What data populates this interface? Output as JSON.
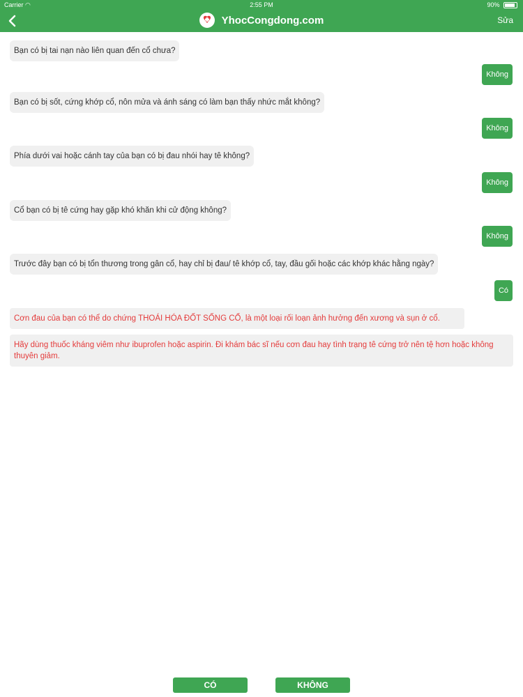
{
  "status": {
    "carrier": "Carrier",
    "time": "2:55 PM",
    "battery": "90%"
  },
  "nav": {
    "brand": "YhocCongdong.com",
    "edit": "Sửa"
  },
  "conversation": [
    {
      "question": "Bạn có bị tai nạn nào liên quan đến cổ chưa?",
      "answer": "Không"
    },
    {
      "question": "Bạn có bị sốt, cứng khớp cổ, nôn mửa và ánh sáng có làm bạn thấy nhức mắt không?",
      "answer": "Không"
    },
    {
      "question": "Phía dưới vai hoặc cánh tay của bạn có bị đau nhói hay tê không?",
      "answer": "Không"
    },
    {
      "question": "Cổ bạn có bị tê cứng hay gặp khó khăn khi cử động không?",
      "answer": "Không"
    },
    {
      "question": "Trước đây bạn có bị tổn thương trong gân cổ, hay chỉ bị đau/ tê khớp cổ, tay, đầu gối hoặc các khớp khác hằng ngày?",
      "answer": "Có"
    }
  ],
  "result": {
    "diagnosis": "Cơn đau của bạn có thể do chứng THOÁI HÓA ĐỐT SỐNG CỔ, là một loại rối loạn ảnh hưởng đến xương và sụn ở cổ.",
    "advice": "Hãy dùng thuốc kháng viêm như ibuprofen hoặc aspirin. Đi khám bác sĩ nếu cơn đau hay tình trạng tê cứng trở nên tệ hơn hoặc không thuyên giảm."
  },
  "buttons": {
    "yes": "CÓ",
    "no": "KHÔNG"
  },
  "colors": {
    "brand_green": "#3fa653",
    "alert_red": "#e43b3b",
    "bubble_gray": "#f0f0f0"
  }
}
